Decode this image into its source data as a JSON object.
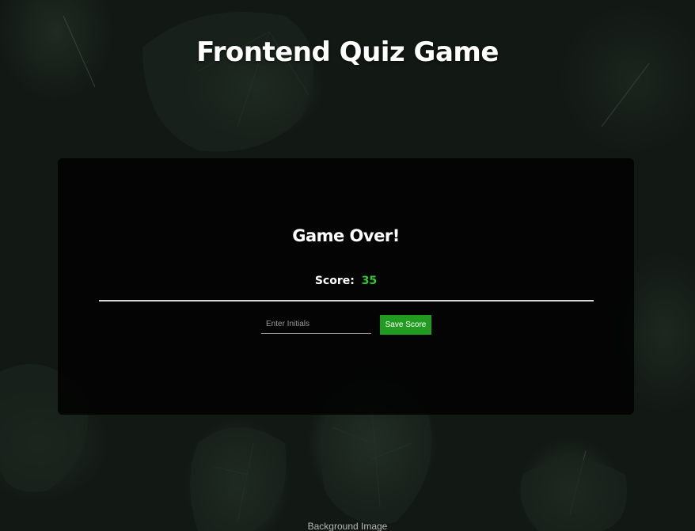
{
  "header": {
    "title": "Frontend Quiz Game"
  },
  "result_card": {
    "heading": "Game Over!",
    "score_label": "Score:",
    "score_value": "35",
    "initials_placeholder": "Enter Initials",
    "initials_value": "",
    "save_button_label": "Save Score"
  },
  "footer": {
    "background_credit": "Background Image"
  },
  "colors": {
    "accent_green": "#219c21",
    "score_green": "#32c832",
    "card_background": "#000000"
  }
}
